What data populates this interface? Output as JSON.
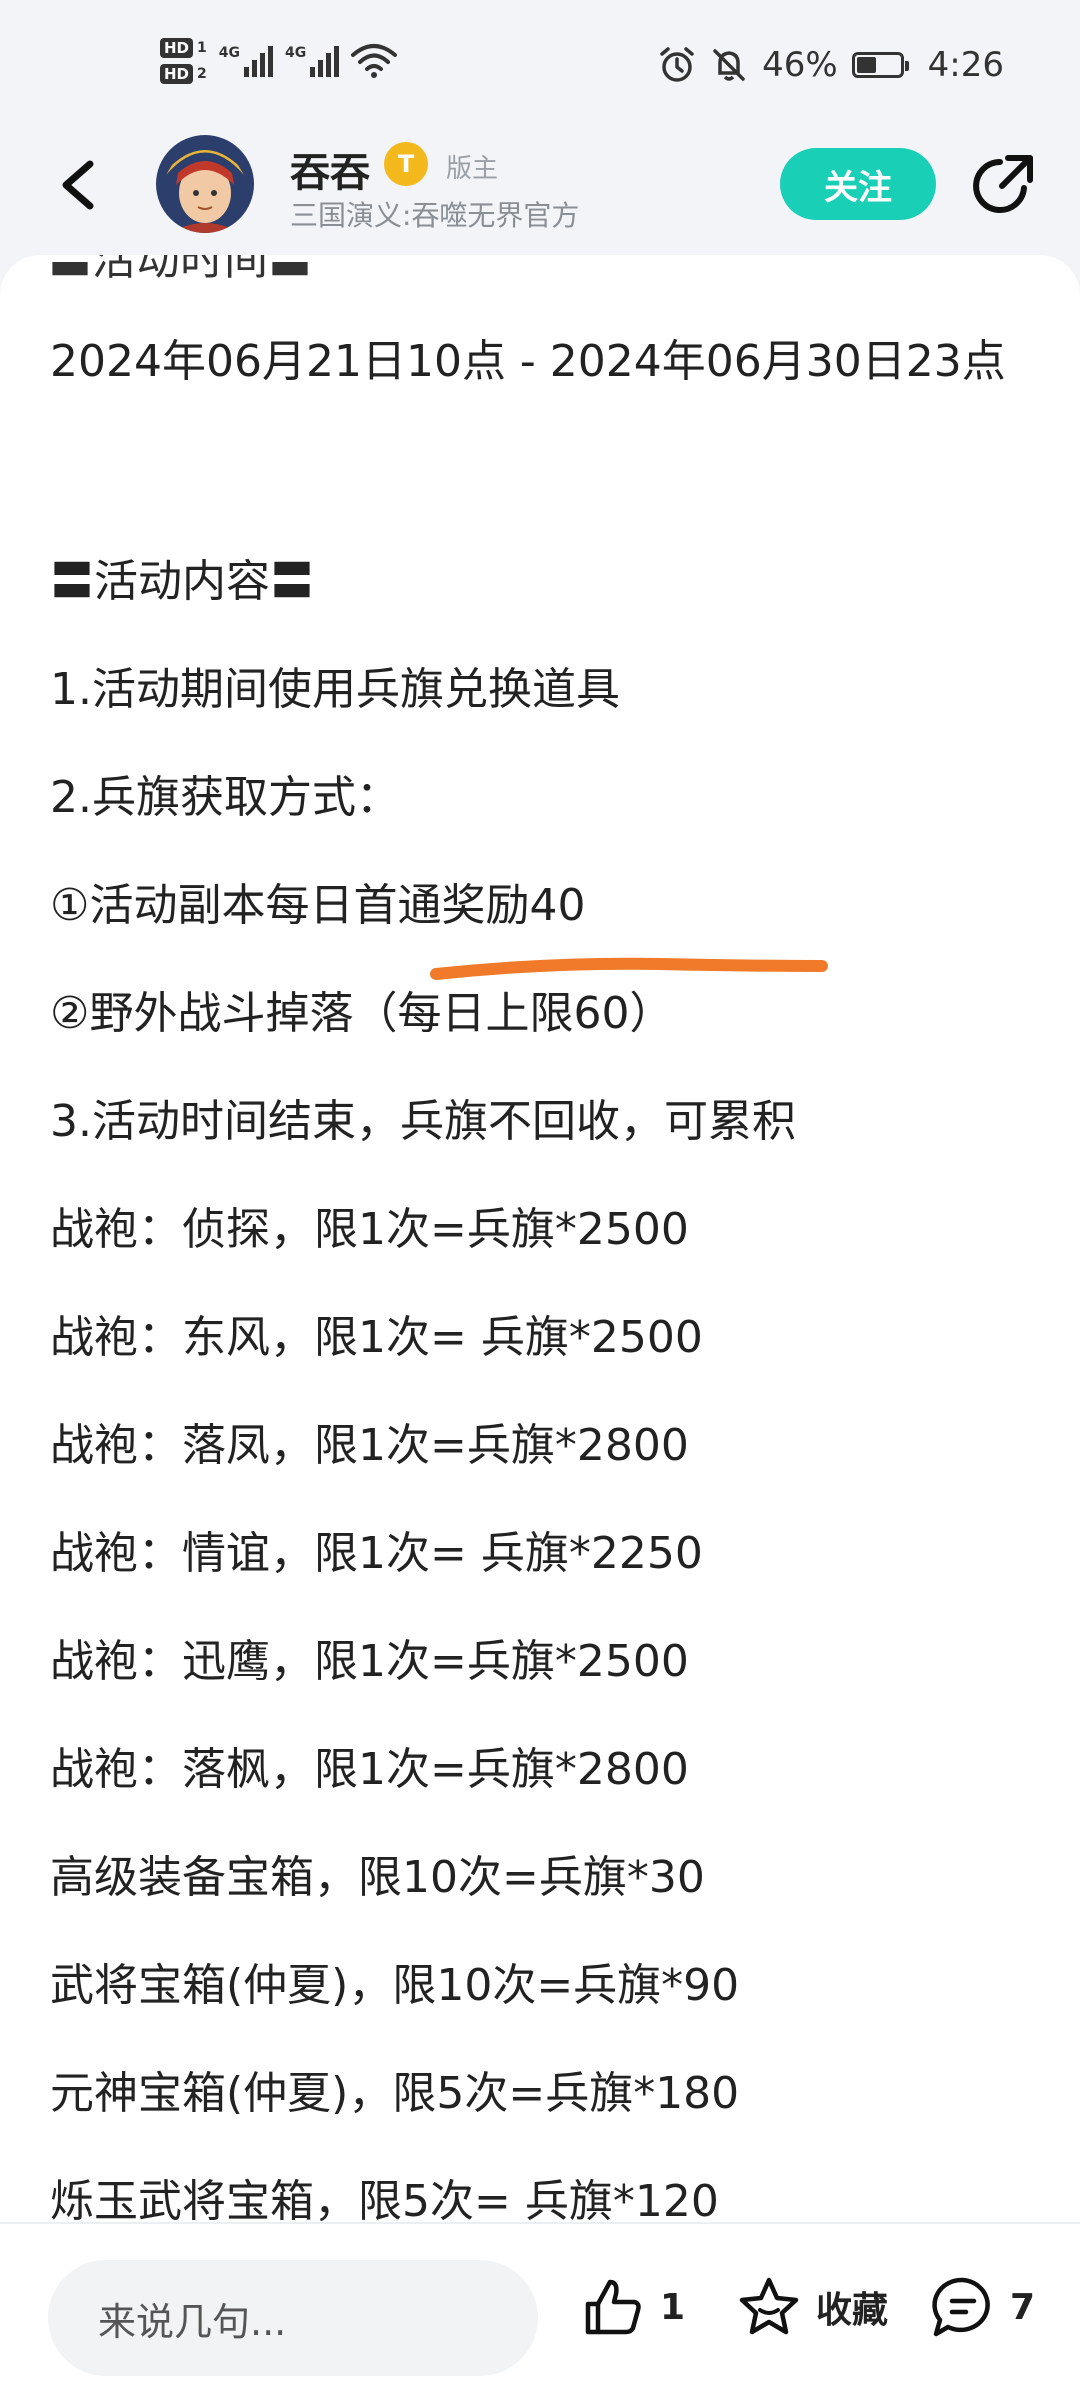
{
  "status_bar": {
    "hd1": "HD",
    "sim1": "1",
    "hd2": "HD",
    "sim2": "2",
    "net1": "4G",
    "net2": "4G",
    "battery_percent": "46%",
    "battery_level": 0.46,
    "time": "4:26"
  },
  "header": {
    "author_name": "吞吞",
    "badge_text": "T",
    "role": "版主",
    "subtitle": "三国演义:吞噬无界官方",
    "follow_label": "关注"
  },
  "content": {
    "cut_off_heading": "〓活动时间〓",
    "lines": [
      "2024年06月21日10点 - 2024年06月30日23点",
      "〓活动内容〓",
      "1.活动期间使用兵旗兑换道具",
      "2.兵旗获取方式：",
      "①活动副本每日首通奖励40",
      "②野外战斗掉落（每日上限60）",
      "3.活动时间结束，兵旗不回收，可累积",
      "战袍：侦探，限1次=兵旗*2500",
      "战袍：东风，限1次= 兵旗*2500",
      "战袍：落凤，限1次=兵旗*2800",
      "战袍：情谊，限1次= 兵旗*2250",
      "战袍：迅鹰，限1次=兵旗*2500",
      "战袍：落枫，限1次=兵旗*2800",
      "高级装备宝箱，限10次=兵旗*30",
      "武将宝箱(仲夏)，限10次=兵旗*90",
      "元神宝箱(仲夏)，限5次=兵旗*180",
      "烁玉武将宝箱，限5次= 兵旗*120"
    ]
  },
  "bottom_bar": {
    "comment_placeholder": "来说几句...",
    "like_count": "1",
    "favorite_label": "收藏",
    "comment_count": "7"
  },
  "colors": {
    "accent": "#19d0b6",
    "underline": "#f07a2a",
    "badge": "#f3b91c"
  }
}
